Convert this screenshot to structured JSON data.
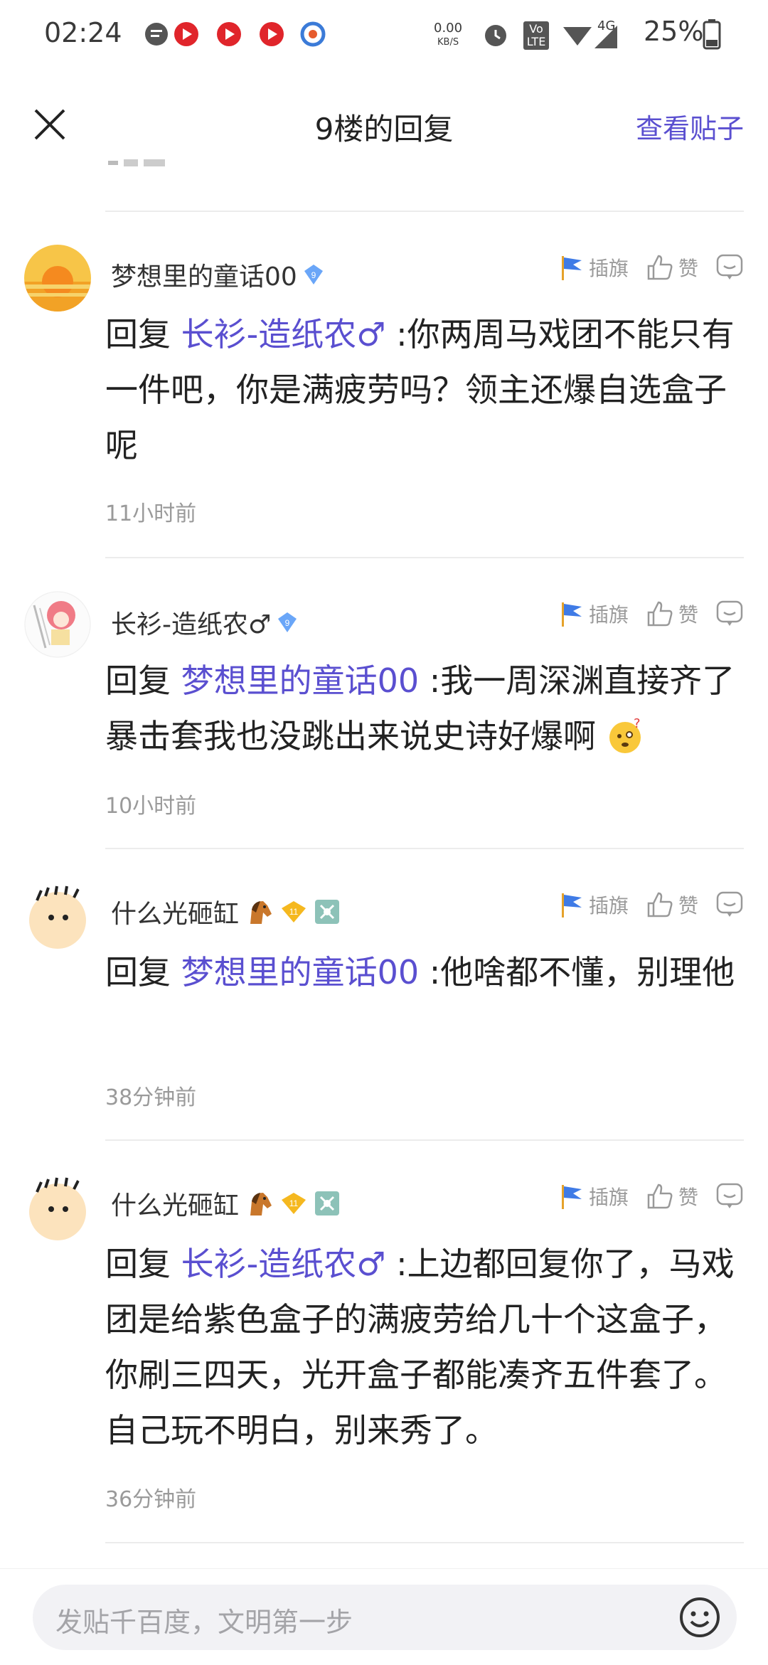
{
  "status_bar": {
    "time": "02:24",
    "net_speed_value": "0.00",
    "net_speed_unit": "KB/S",
    "volte": "Vo LTE",
    "network": "4G",
    "battery": "25%",
    "icons": [
      "message-icon",
      "app-icon",
      "app-icon",
      "app-icon",
      "browser-icon",
      "alarm-icon",
      "signal-icon",
      "battery-icon"
    ]
  },
  "header": {
    "title": "9楼的回复",
    "view_post": "查看贴子"
  },
  "actions": {
    "flag_label": "插旗",
    "like_label": "赞"
  },
  "comments": [
    {
      "username": "梦想里的童话00",
      "level": "9",
      "reply_prefix": "回复 ",
      "mention": "长衫-造纸农♂",
      "text": " :你两周马戏团不能只有一件吧，你是满疲劳吗？领主还爆自选盒子呢",
      "time": "11小时前"
    },
    {
      "username": "长衫-造纸农♂",
      "level": "9",
      "reply_prefix": "回复 ",
      "mention": "梦想里的童话00",
      "text": " :我一周深渊直接齐了暴击套我也没跳出来说史诗好爆啊",
      "time": "10小时前"
    },
    {
      "username": "什么光砸缸",
      "level": "11",
      "reply_prefix": "回复 ",
      "mention": "梦想里的童话00",
      "text": " :他啥都不懂，别理他",
      "time": "38分钟前"
    },
    {
      "username": "什么光砸缸",
      "level": "11",
      "reply_prefix": "回复 ",
      "mention": "长衫-造纸农♂",
      "text": " :上边都回复你了，马戏团是给紫色盒子的满疲劳给几十个这盒子，你刷三四天，光开盒子都能凑齐五件套了。自己玩不明白，别来秀了。",
      "time": "36分钟前"
    }
  ],
  "input": {
    "placeholder": "发贴千百度，文明第一步"
  }
}
